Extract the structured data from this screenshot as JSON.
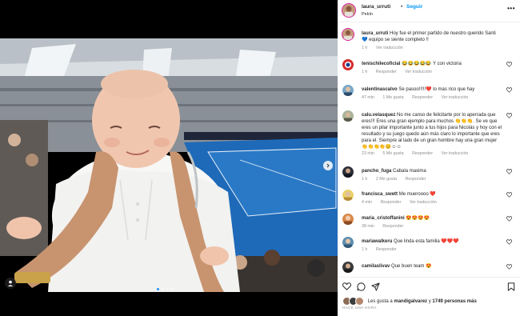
{
  "post": {
    "username": "laura_urruti",
    "follow_label": "Seguir",
    "location": "Pekín",
    "more_icon": "more-horizontal-icon",
    "caption": {
      "username": "laura_urruti",
      "text": "Hoy fue el primer partido de nuestro querido Santi 💙 equipo se siente completo !!",
      "time": "1 h",
      "translation": "Ver traducción"
    },
    "photo": {
      "carousel_index": 1,
      "carousel_total": 4
    }
  },
  "comments": [
    {
      "username": "tenischilecoficial",
      "text": "😂😂😂😂😂 Y con victoria",
      "time": "1 h",
      "likes": "",
      "reply": "Responder",
      "translation": "Ver traducción"
    },
    {
      "username": "valentinascalvo",
      "text": "Se pasoo!!!!!❤️ lo mas rico que hay",
      "time": "47 min",
      "likes": "1 Me gusta",
      "reply": "Responder",
      "translation": "Ver traducción"
    },
    {
      "username": "calu.velasquez",
      "text": "No me canso de felicitarte por lo aperrada que eres!!! Eres una gran ejemplo para muchos 👏👏👏. Se ve que eres un pilar importante junto a tus hijos para Nicolás y hoy con el resultado y su juego quedo aún más claro lo importante que eres para el. Siempre al lado de un gran hombre hay una gran mujer 👏👏👏👏😊☺☺",
      "time": "23 min",
      "likes": "5 Me gusta",
      "reply": "Responder",
      "translation": "Ver traducción"
    },
    {
      "username": "pancho_fuga",
      "text": "Cabala maxima",
      "time": "1 h",
      "likes": "2 Me gusta",
      "reply": "Responder",
      "translation": ""
    },
    {
      "username": "francisca_swett",
      "text": "Me mueroooo ❤️",
      "time": "4 min",
      "likes": "",
      "reply": "Responder",
      "translation": "Ver traducción"
    },
    {
      "username": "maria_cristoffanini",
      "text": "😍😍😍😍",
      "time": "38 min",
      "likes": "",
      "reply": "Responder",
      "translation": ""
    },
    {
      "username": "mariawalkeru",
      "text": "Que linda esta familia ❤️❤️❤️",
      "time": "1 h",
      "likes": "",
      "reply": "Responder",
      "translation": ""
    },
    {
      "username": "camilaslivav",
      "text": "Que buen team 😍",
      "time": "",
      "likes": "",
      "reply": "",
      "translation": ""
    }
  ],
  "actions": {
    "like_icon": "heart-icon",
    "comment_icon": "comment-icon",
    "share_icon": "paper-plane-icon",
    "save_icon": "bookmark-icon"
  },
  "likes_summary": {
    "prefix": "Les gusta a",
    "user": "mandigalvarez",
    "suffix": "y",
    "others": "1749 personas más"
  },
  "time_ago": "HACE UNA HORA",
  "colors": {
    "follow": "#0095f6",
    "secondary_text": "#8e8e8e",
    "carousel_active": "#1e90ff",
    "court_blue": "#1e6ab8"
  }
}
